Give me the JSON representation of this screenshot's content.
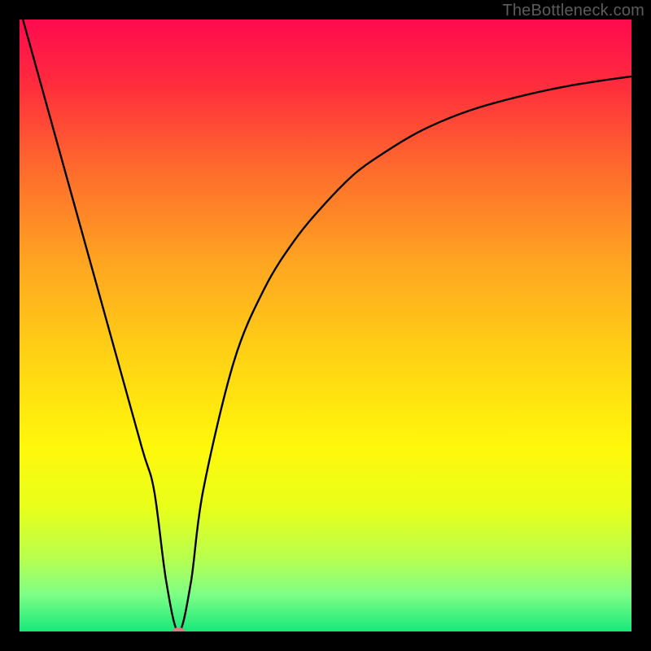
{
  "watermark": "TheBottleneck.com",
  "chart_data": {
    "type": "line",
    "title": "",
    "xlabel": "",
    "ylabel": "",
    "xlim": [
      0,
      100
    ],
    "ylim": [
      0,
      100
    ],
    "grid": false,
    "series": [
      {
        "name": "curve",
        "x": [
          0,
          5,
          10,
          15,
          20,
          22,
          24,
          26,
          28,
          30,
          35,
          40,
          45,
          50,
          55,
          60,
          65,
          70,
          75,
          80,
          85,
          90,
          95,
          100
        ],
        "y": [
          102,
          84,
          66,
          48,
          30,
          23,
          8,
          0,
          8,
          23,
          44,
          56,
          64,
          70,
          75,
          78.5,
          81.5,
          83.8,
          85.6,
          87,
          88.2,
          89.2,
          90,
          90.7
        ]
      }
    ],
    "gradient_stops": [
      {
        "offset": 0.0,
        "color": "#ff0b4f"
      },
      {
        "offset": 0.1,
        "color": "#ff2a3e"
      },
      {
        "offset": 0.25,
        "color": "#ff6d2c"
      },
      {
        "offset": 0.4,
        "color": "#ffa621"
      },
      {
        "offset": 0.55,
        "color": "#ffd214"
      },
      {
        "offset": 0.7,
        "color": "#fff80b"
      },
      {
        "offset": 0.8,
        "color": "#e7ff1b"
      },
      {
        "offset": 0.88,
        "color": "#b8ff4e"
      },
      {
        "offset": 0.94,
        "color": "#7dff86"
      },
      {
        "offset": 1.0,
        "color": "#17e87a"
      }
    ],
    "marker": {
      "x": 26,
      "y": 0,
      "rx": 8,
      "ry": 5,
      "color": "#d77d80"
    }
  }
}
